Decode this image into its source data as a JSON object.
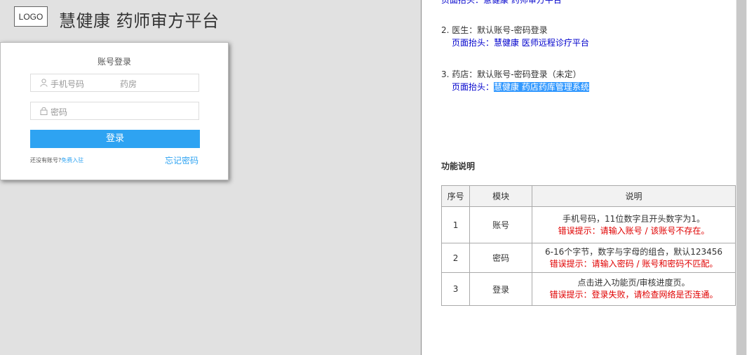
{
  "header": {
    "logo_text": "LOGO",
    "app_title": "慧健康  药师审方平台"
  },
  "login": {
    "title": "账号登录",
    "phone_placeholder": "手机号码",
    "phone_extra": "药房",
    "password_placeholder": "密码",
    "submit_label": "登录",
    "no_account_text": "还没有账号?",
    "register_link": "免费入驻",
    "forgot_link": "忘记密码"
  },
  "notes": {
    "cut_line": "页面抬头：慧健康 药师审方平台",
    "doctor": {
      "line": "2. 医生：默认账号-密码登录",
      "header_prefix": "页面抬头：",
      "header_value": "慧健康 医师远程诊疗平台"
    },
    "pharmacy": {
      "line": "3. 药店：默认账号-密码登录（未定）",
      "header_prefix": "页面抬头：",
      "header_value": "慧健康 药店药库管理系统"
    }
  },
  "spec": {
    "title": "功能说明",
    "headers": [
      "序号",
      "模块",
      "说明"
    ],
    "rows": [
      {
        "no": "1",
        "module": "账号",
        "desc": "手机号码，11位数字且开头数字为1。",
        "error": "错误提示：请输入账号 / 该账号不存在。"
      },
      {
        "no": "2",
        "module": "密码",
        "desc": "6-16个字节，数字与字母的组合，默认123456",
        "error": "错误提示：请输入密码 / 账号和密码不匹配。"
      },
      {
        "no": "3",
        "module": "登录",
        "desc": "点击进入功能页/审核进度页。",
        "error": "错误提示：登录失败，请检查网络是否连通。"
      }
    ]
  },
  "colors": {
    "accent": "#2ea3f2",
    "error": "#e00000",
    "link_blue": "#0000cc",
    "highlight": "#3399ff"
  }
}
